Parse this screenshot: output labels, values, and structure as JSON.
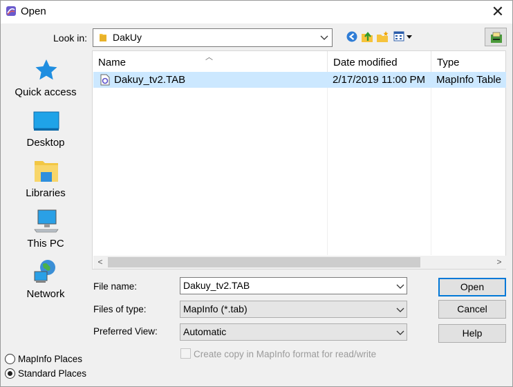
{
  "window": {
    "title": "Open",
    "close_glyph": "✕"
  },
  "toolbar": {
    "look_in_label": "Look in:",
    "look_in_value": "DakUy",
    "icons": [
      "back-icon",
      "up-folder-icon",
      "new-folder-icon",
      "views-menu-icon",
      "extra-tool-icon"
    ]
  },
  "places": [
    {
      "label": "Quick access",
      "icon": "star-icon"
    },
    {
      "label": "Desktop",
      "icon": "desktop-icon"
    },
    {
      "label": "Libraries",
      "icon": "libraries-icon"
    },
    {
      "label": "This PC",
      "icon": "computer-icon"
    },
    {
      "label": "Network",
      "icon": "network-icon"
    }
  ],
  "file_list": {
    "columns": [
      "Name",
      "Date modified",
      "Type"
    ],
    "rows": [
      {
        "name": "Dakuy_tv2.TAB",
        "date": "2/17/2019 11:00 PM",
        "type": "MapInfo Table",
        "selected": true
      }
    ],
    "scroll_left_glyph": "<",
    "scroll_right_glyph": ">"
  },
  "fields": {
    "file_name_label": "File name:",
    "file_name_value": "Dakuy_tv2.TAB",
    "files_of_type_label": "Files of type:",
    "files_of_type_value": "MapInfo (*.tab)",
    "preferred_view_label": "Preferred View:",
    "preferred_view_value": "Automatic"
  },
  "buttons": {
    "open": "Open",
    "cancel": "Cancel",
    "help": "Help"
  },
  "copy_checkbox": {
    "label": "Create copy in MapInfo format for read/write",
    "checked": false,
    "enabled": false
  },
  "place_mode": {
    "mapinfo_label": "MapInfo Places",
    "standard_label": "Standard Places",
    "selected": "standard"
  },
  "colors": {
    "selection": "#cce8ff",
    "accent": "#0078d7",
    "dialog_bg": "#f0f0f0"
  }
}
